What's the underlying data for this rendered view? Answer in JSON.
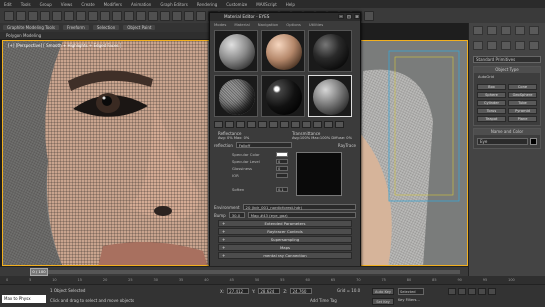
{
  "menubar": [
    "Edit",
    "Tools",
    "Group",
    "Views",
    "Create",
    "Modifiers",
    "Animation",
    "Graph Editors",
    "Rendering",
    "Customize",
    "MAXScript",
    "Help"
  ],
  "ribbon": {
    "tabs": [
      "Graphite Modeling Tools",
      "Freeform",
      "Selection",
      "Object Paint"
    ],
    "sub": "Polygon Modeling"
  },
  "viewport": {
    "label": "[+] [Perspective] [ Smooth + Highlights + Edged Faces ]"
  },
  "command_panel": {
    "dropdown": "Standard Primitives",
    "object_type_title": "Object Type",
    "autogrid": "AutoGrid",
    "buttons": [
      "Box",
      "Cone",
      "Sphere",
      "GeoSphere",
      "Cylinder",
      "Tube",
      "Torus",
      "Pyramid",
      "Teapot",
      "Plane"
    ],
    "name_color_title": "Name and Color",
    "name_value": "Eye"
  },
  "material_editor": {
    "title": "Material Editor - EYES",
    "menu": [
      "Modes",
      "Material",
      "Navigation",
      "Options",
      "Utilities"
    ],
    "spheres": [
      "sph-grey",
      "sph-skin",
      "sph-dark",
      "sph-wire",
      "sph-shiny",
      "sph-mid"
    ],
    "reflectance_left": "Reflectance",
    "reflectance_left_vals": "Avg: 0%  Max: 0%",
    "reflectance_right": "Transmittance",
    "reflectance_right_vals": "Avg:100%  Max:100%  Diffuse: 0%",
    "map_label": "reflection",
    "map_type": "Falloff",
    "raytrace": "RayTrace",
    "specular_color": "Specular Color",
    "specular_level": "Specular Level",
    "glossiness": "Glossiness",
    "ior_label": "IOR",
    "softener": "Soften",
    "val_spec": "0",
    "val_gloss": "0",
    "val_soft": "0.1",
    "environment_label": "Environment",
    "environment_map": "20 (kdr_001_nordicforest.hdr)",
    "bump_label": "Bump",
    "bump_map": "Map #43 (eye_gaz)",
    "bump_amount": "30.0",
    "rollouts": [
      "Extended Parameters",
      "Raytracer Controls",
      "Supersampling",
      "Maps",
      "mental ray Connection"
    ]
  },
  "timeline": {
    "thumb": "0 / 100"
  },
  "ruler": [
    "0",
    "5",
    "10",
    "15",
    "20",
    "25",
    "30",
    "35",
    "40",
    "45",
    "50",
    "55",
    "60",
    "65",
    "70",
    "75",
    "80",
    "85",
    "90",
    "95",
    "100"
  ],
  "status": {
    "maxscript": "Max to Physx",
    "line1": "1 Object Selected",
    "line2": "Click and drag to select and move objects",
    "x_label": "X:",
    "x_val": "27.412",
    "y_label": "Y:",
    "y_val": "28.624",
    "z_label": "Z:",
    "z_val": "24.760",
    "grid": "Grid = 10.0",
    "addtime": "Add Time Tag",
    "autokey": "Auto Key",
    "selected": "Selected",
    "setkey": "Set Key",
    "keyfilters": "Key Filters..."
  }
}
